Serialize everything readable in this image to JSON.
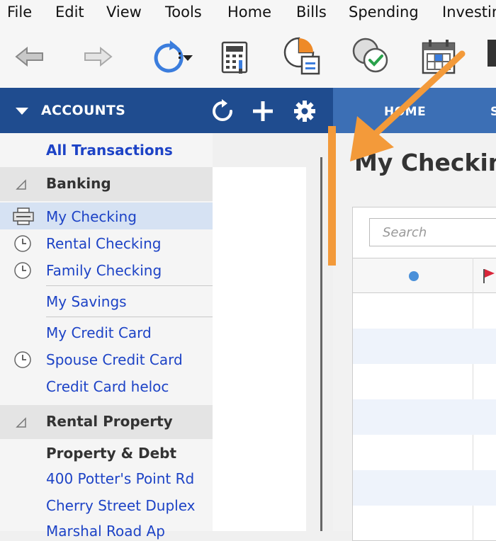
{
  "menu": [
    "File",
    "Edit",
    "View",
    "Tools",
    "Home",
    "Bills",
    "Spending",
    "Investin"
  ],
  "toolbar": {
    "icons": [
      "back-arrow-icon",
      "forward-arrow-icon",
      "refresh-icon",
      "calculator-icon",
      "reports-icon",
      "reconcile-icon",
      "calendar-icon"
    ]
  },
  "accounts_header": {
    "title": "ACCOUNTS",
    "buttons": [
      "refresh-icon",
      "add-icon",
      "gear-icon"
    ]
  },
  "tabs": [
    "HOME",
    "S"
  ],
  "sidebar": {
    "all_transactions": "All Transactions",
    "banking": {
      "label": "Banking",
      "items": [
        "My Checking",
        "Rental Checking",
        "Family Checking",
        "My Savings",
        "My Credit Card",
        "Spouse Credit Card",
        "Credit Card heloc"
      ]
    },
    "rental": {
      "label": "Rental Property",
      "subheader": "Property & Debt",
      "items": [
        "400 Potter's Point Rd",
        "Cherry Street Duplex",
        "Marshal Road Ap"
      ]
    }
  },
  "main": {
    "title": "My Checkin",
    "search_placeholder": "Search"
  },
  "colors": {
    "header": "#1f4c8f",
    "tab_bar": "#3c6fb5",
    "link": "#1d43c6",
    "arrow": "#f39a3a",
    "selected": "#d6e2f3"
  }
}
